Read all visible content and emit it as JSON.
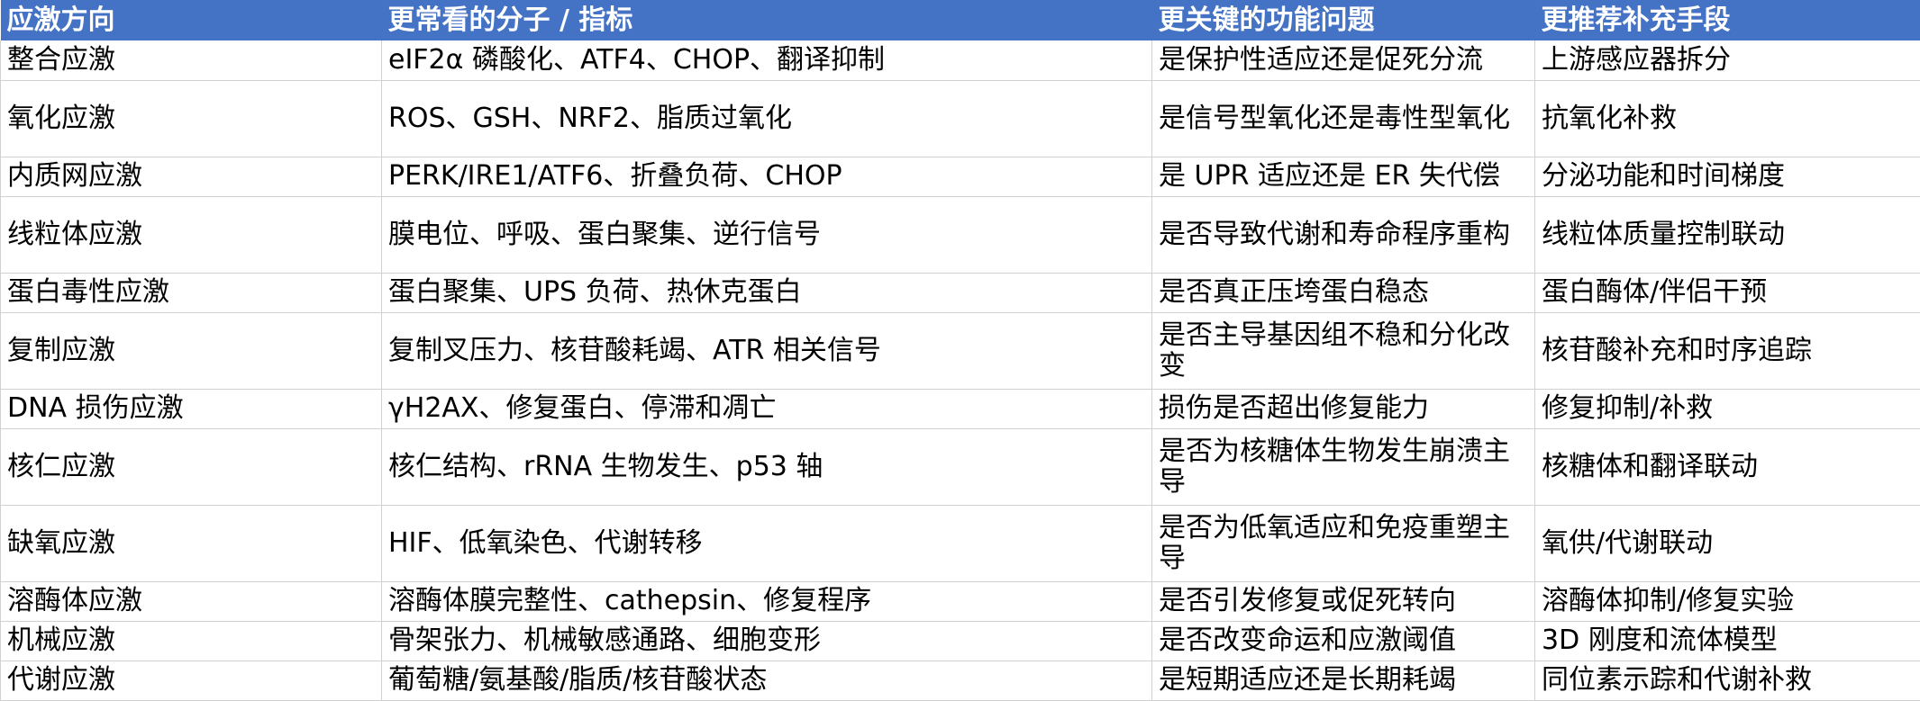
{
  "header": {
    "col_direction": "应激方向",
    "col_molecules": "更常看的分子 / 指标",
    "col_question": "更关键的功能问题",
    "col_solution": "更推荐补充手段"
  },
  "rows": [
    {
      "direction": "整合应激",
      "molecules": "eIF2α 磷酸化、ATF4、CHOP、翻译抑制",
      "question": "是保护性适应还是促死分流",
      "solution": "上游感应器拆分"
    },
    {
      "direction": "氧化应激",
      "molecules": "ROS、GSH、NRF2、脂质过氧化",
      "question": "是信号型氧化还是毒性型氧化",
      "solution": "抗氧化补救"
    },
    {
      "direction": "内质网应激",
      "molecules": "PERK/IRE1/ATF6、折叠负荷、CHOP",
      "question": "是 UPR 适应还是 ER 失代偿",
      "solution": "分泌功能和时间梯度"
    },
    {
      "direction": "线粒体应激",
      "molecules": "膜电位、呼吸、蛋白聚集、逆行信号",
      "question": "是否导致代谢和寿命程序重构",
      "solution": "线粒体质量控制联动"
    },
    {
      "direction": "蛋白毒性应激",
      "molecules": "蛋白聚集、UPS 负荷、热休克蛋白",
      "question": "是否真正压垮蛋白稳态",
      "solution": "蛋白酶体/伴侣干预"
    },
    {
      "direction": "复制应激",
      "molecules": "复制叉压力、核苷酸耗竭、ATR 相关信号",
      "question": "是否主导基因组不稳和分化改变",
      "solution": "核苷酸补充和时序追踪"
    },
    {
      "direction": "DNA 损伤应激",
      "molecules": "γH2AX、修复蛋白、停滞和凋亡",
      "question": "损伤是否超出修复能力",
      "solution": "修复抑制/补救"
    },
    {
      "direction": "核仁应激",
      "molecules": "核仁结构、rRNA 生物发生、p53 轴",
      "question": "是否为核糖体生物发生崩溃主导",
      "solution": "核糖体和翻译联动"
    },
    {
      "direction": "缺氧应激",
      "molecules": "HIF、低氧染色、代谢转移",
      "question": "是否为低氧适应和免疫重塑主导",
      "solution": "氧供/代谢联动"
    },
    {
      "direction": "溶酶体应激",
      "molecules": "溶酶体膜完整性、cathepsin、修复程序",
      "question": "是否引发修复或促死转向",
      "solution": "溶酶体抑制/修复实验"
    },
    {
      "direction": "机械应激",
      "molecules": "骨架张力、机械敏感通路、细胞变形",
      "question": "是否改变命运和应激阈值",
      "solution": "3D 刚度和流体模型"
    },
    {
      "direction": "代谢应激",
      "molecules": "葡萄糖/氨基酸/脂质/核苷酸状态",
      "question": "是短期适应还是长期耗竭",
      "solution": "同位素示踪和代谢补救"
    }
  ]
}
